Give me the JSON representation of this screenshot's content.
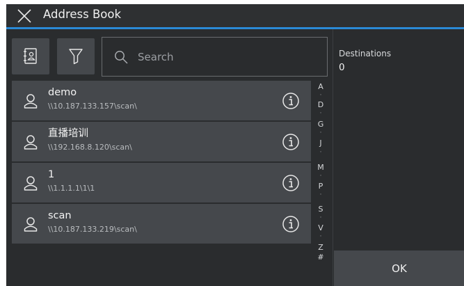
{
  "header": {
    "title": "Address Book",
    "close_icon": "close-icon"
  },
  "toolbar": {
    "addressbook_icon": "address-book-icon",
    "filter_icon": "filter-icon",
    "search_placeholder": "Search",
    "search_value": ""
  },
  "entries": [
    {
      "name": "demo",
      "path": "\\\\10.187.133.157\\scan\\"
    },
    {
      "name": "直播培训",
      "path": "\\\\192.168.8.120\\scan\\"
    },
    {
      "name": "1",
      "path": "\\\\1.1.1.1\\1\\1"
    },
    {
      "name": "scan",
      "path": "\\\\10.187.133.219\\scan\\"
    }
  ],
  "alpha_index": [
    "A",
    "D",
    "G",
    "J",
    "M",
    "P",
    "S",
    "V",
    "Z",
    "#"
  ],
  "destinations": {
    "label": "Destinations",
    "count": "0"
  },
  "ok_label": "OK",
  "colors": {
    "accent": "#2a8ad6",
    "background": "#2a2c2e",
    "button": "#45484c"
  }
}
